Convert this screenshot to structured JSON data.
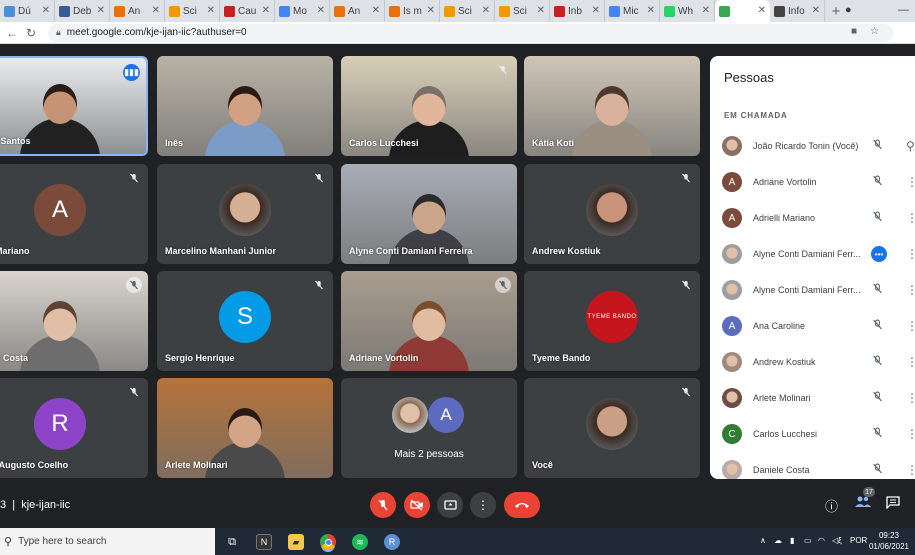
{
  "browser": {
    "tabs": [
      {
        "label": "Dú",
        "color": "#4a90d9"
      },
      {
        "label": "Deb",
        "color": "#3b5998"
      },
      {
        "label": "An",
        "color": "#e8710a"
      },
      {
        "label": "Sci",
        "color": "#f29900"
      },
      {
        "label": "Cau",
        "color": "#c5221f"
      },
      {
        "label": "Mo",
        "color": "#4285f4"
      },
      {
        "label": "An",
        "color": "#e8710a"
      },
      {
        "label": "Is m",
        "color": "#e8710a"
      },
      {
        "label": "Sci",
        "color": "#f29900"
      },
      {
        "label": "Sci",
        "color": "#f29900"
      },
      {
        "label": "Inb",
        "color": "#c5221f"
      },
      {
        "label": "Mic",
        "color": "#4285f4"
      },
      {
        "label": "Wh",
        "color": "#25d366"
      },
      {
        "label": "",
        "color": "#34a853"
      },
      {
        "label": "Info",
        "color": "#444"
      }
    ],
    "new_tab": "+",
    "url": "meet.google.com/kje-ijan-iic?authuser=0"
  },
  "tiles": [
    {
      "name": "nilo Santos",
      "kind": "cam",
      "bg": "#e9ecef",
      "hair": "#2a1d16",
      "skin": "#c69474",
      "shirt": "#222",
      "speaking": true
    },
    {
      "name": "Inês",
      "kind": "cam",
      "bg": "#b9b3a6",
      "hair": "#2b1a12",
      "skin": "#d2a184",
      "shirt": "#7a9cc6"
    },
    {
      "name": "Carlos Lucchesi",
      "kind": "cam",
      "bg": "#d8cfb8",
      "hair": "#7c6f68",
      "skin": "#e2b69a",
      "shirt": "#1e1e1e",
      "muted": true
    },
    {
      "name": "Kátia Koti",
      "kind": "cam",
      "bg": "#cfc6b7",
      "hair": "#4b3a2c",
      "skin": "#d8b29a",
      "shirt": "#9a8f82"
    },
    {
      "name": "elli Mariano",
      "kind": "avatar",
      "letter": "A",
      "color": "#7b4a3a",
      "muted": true
    },
    {
      "name": "Marcelino Manhani Junior",
      "kind": "photo",
      "skin": "#d5b095",
      "muted": true
    },
    {
      "name": "Alyne Conti Damiani Ferreira",
      "kind": "cam",
      "bg": "#a8adb5",
      "hair": "#2b2b2b",
      "skin": "#caa58a",
      "shirt": "#3f3f46"
    },
    {
      "name": "Andrew Kostiuk",
      "kind": "photo",
      "skin": "#c9957a",
      "muted": true
    },
    {
      "name": "niele Costa",
      "kind": "cam",
      "bg": "#d9d4cd",
      "hair": "#5b4433",
      "skin": "#e0bfa6",
      "shirt": "#6d6d6d",
      "mutedw": true
    },
    {
      "name": "Sergio Henrique",
      "kind": "avatar",
      "letter": "S",
      "color": "#039be5",
      "muted": true
    },
    {
      "name": "Adriane Vortolin",
      "kind": "cam",
      "bg": "#a99d8e",
      "hair": "#7a4d2e",
      "skin": "#e2bca0",
      "shirt": "#8f3a35",
      "mutedw": true
    },
    {
      "name": "Tyeme Bando",
      "kind": "logo",
      "logo": "TYEME BANDO",
      "muted": true
    },
    {
      "name": "ério Augusto Coelho",
      "kind": "avatar",
      "letter": "R",
      "color": "#8e44c9",
      "muted": true
    },
    {
      "name": "Arlete Molinari",
      "kind": "cam",
      "bg": "#b5733a",
      "hair": "#2a1a14",
      "skin": "#d3a486",
      "shirt": "#4a4a4a"
    },
    {
      "name": "Mais 2 pessoas",
      "kind": "more",
      "letter": "A",
      "color": "#5c6bc0"
    },
    {
      "name": "Você",
      "kind": "photo",
      "skin": "#c99f85",
      "muted": true
    }
  ],
  "panel": {
    "title": "Pessoas",
    "section": "EM CHAMADA",
    "people": [
      {
        "name": "João Ricardo Tonin (Você)",
        "avatar": "",
        "color": "#8d6e63",
        "pin": true
      },
      {
        "name": "Adriane Vortolin",
        "avatar": "A",
        "color": "#7b4a3a"
      },
      {
        "name": "Adrielli Mariano",
        "avatar": "A",
        "color": "#7b4a3a"
      },
      {
        "name": "Alyne Conti Damiani Ferr...",
        "avatar": "",
        "color": "#9e9e9e",
        "speaking": true
      },
      {
        "name": "Alyne Conti Damiani Ferr...",
        "avatar": "",
        "color": "#9e9e9e"
      },
      {
        "name": "Ana Caroline",
        "avatar": "A",
        "color": "#5c6bc0"
      },
      {
        "name": "Andrew Kostiuk",
        "avatar": "",
        "color": "#a1887f"
      },
      {
        "name": "Arlete Molinari",
        "avatar": "",
        "color": "#6d4c41"
      },
      {
        "name": "Carlos Lucchesi",
        "avatar": "C",
        "color": "#2e7d32"
      },
      {
        "name": "Daniele Costa",
        "avatar": "",
        "color": "#bcaaa4"
      }
    ]
  },
  "meetbar": {
    "code": "kje-ijan-iic",
    "badge": "17"
  },
  "taskbar": {
    "search_placeholder": "Type here to search",
    "lang": "POR",
    "time": "09:23",
    "date": "01/06/2021"
  }
}
